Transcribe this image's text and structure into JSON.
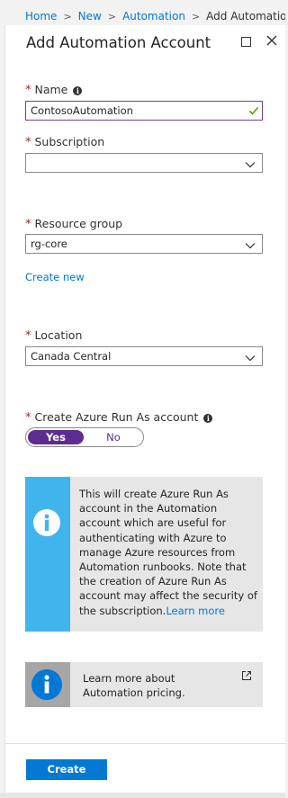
{
  "breadcrumb": {
    "items": [
      "Home",
      "New",
      "Automation"
    ],
    "current": "Add Automation"
  },
  "blade": {
    "title": "Add Automation Account"
  },
  "form": {
    "name": {
      "label": "Name",
      "value": "ContosoAutomation"
    },
    "subscription": {
      "label": "Subscription",
      "value": ""
    },
    "resource_group": {
      "label": "Resource group",
      "value": "rg-core",
      "create_new": "Create new"
    },
    "location": {
      "label": "Location",
      "value": "Canada Central"
    },
    "run_as": {
      "label": "Create Azure Run As account",
      "yes": "Yes",
      "no": "No",
      "selected": "Yes"
    },
    "required_marker": "*"
  },
  "callout": {
    "text": "This will create Azure Run As account in the Automation account which are useful for authenticating with Azure to manage Azure resources from Automation runbooks. Note that the creation of Azure Run As account may affect the security of the subscription.",
    "link": "Learn more"
  },
  "pricing": {
    "text": "Learn more about Automation pricing."
  },
  "footer": {
    "create_label": "Create"
  },
  "colors": {
    "accent": "#0078d4",
    "toggle_selected": "#5c2d91",
    "callout_stripe": "#40b5ec",
    "required": "#a4262c",
    "valid_check": "#57a300"
  },
  "icons": [
    "info-icon",
    "check-icon",
    "chevron-down-icon",
    "maximize-icon",
    "close-icon",
    "external-link-icon"
  ]
}
